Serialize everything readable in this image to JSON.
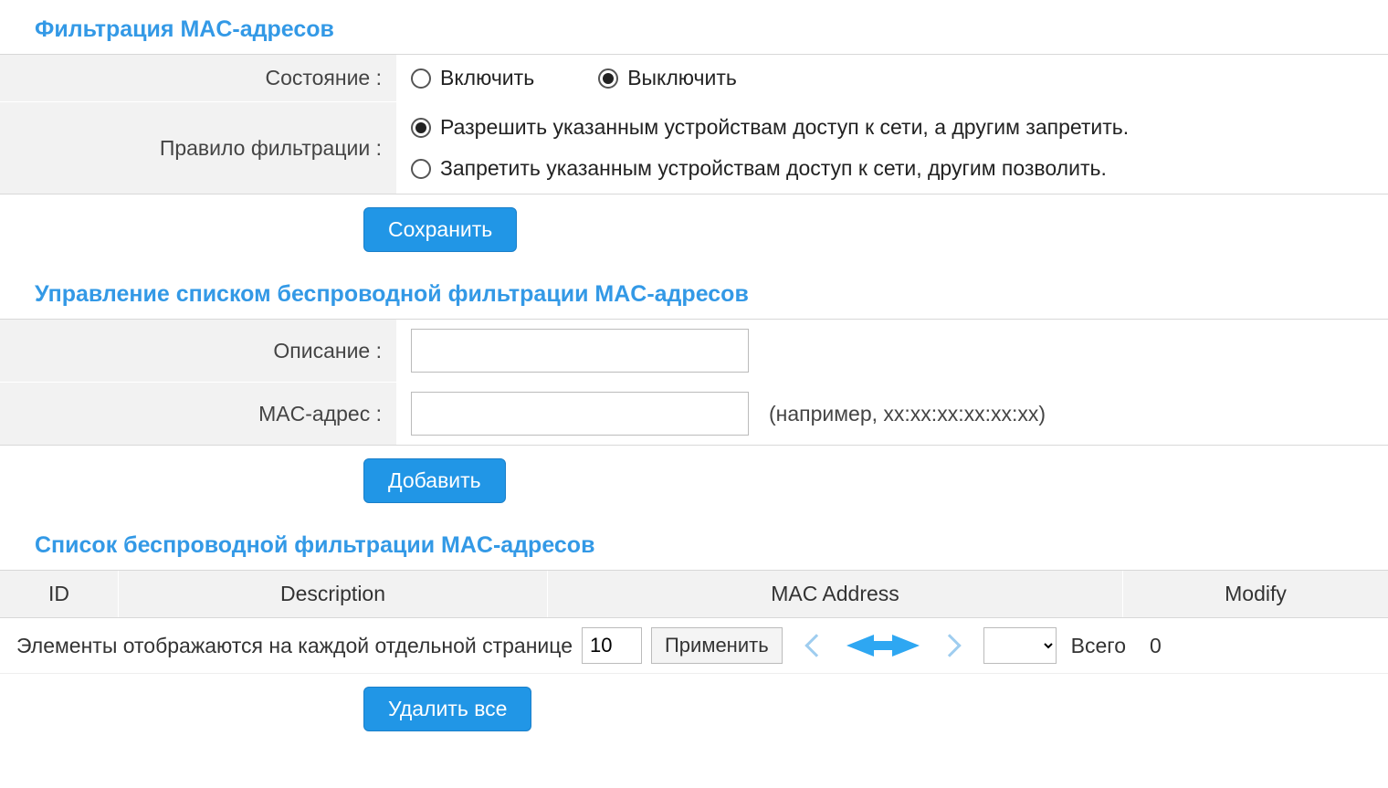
{
  "section1": {
    "title": "Фильтрация MAC-адресов",
    "state_label": "Состояние :",
    "state_enable": "Включить",
    "state_disable": "Выключить",
    "state_selected": "disable",
    "rule_label": "Правило фильтрации :",
    "rule_allow": "Разрешить указанным устройствам доступ к сети, а другим запретить.",
    "rule_deny": "Запретить указанным устройствам доступ к сети, другим позволить.",
    "rule_selected": "allow",
    "save_btn": "Сохранить"
  },
  "section2": {
    "title": "Управление списком беспроводной фильтрации MAC-адресов",
    "desc_label": "Описание :",
    "desc_value": "",
    "mac_label": "MAC-адрес :",
    "mac_value": "",
    "mac_hint": "(например, xx:xx:xx:xx:xx:xx)",
    "add_btn": "Добавить"
  },
  "section3": {
    "title": "Список беспроводной фильтрации MAC-адресов",
    "columns": {
      "id": "ID",
      "desc": "Description",
      "mac": "MAC Address",
      "modify": "Modify"
    },
    "rows": [],
    "pager": {
      "per_page_label": "Элементы отображаются на каждой отдельной странице",
      "per_page_value": "10",
      "apply_btn": "Применить",
      "total_label": "Всего",
      "total_count": "0"
    },
    "delete_all_btn": "Удалить все"
  }
}
